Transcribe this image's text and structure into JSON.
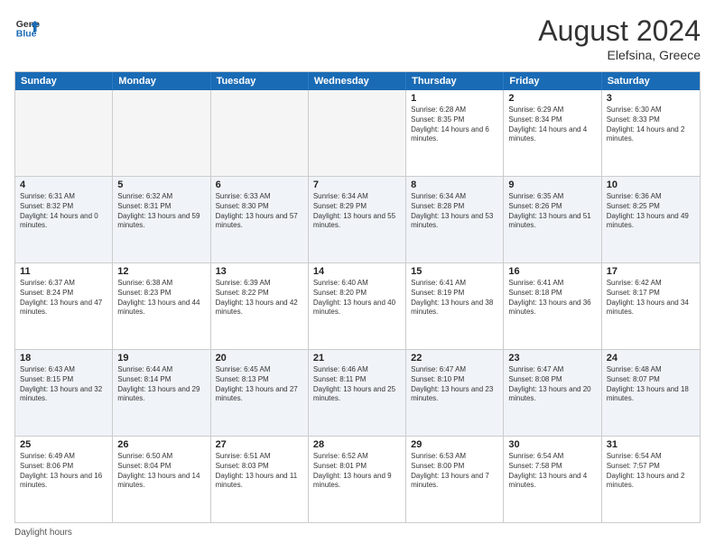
{
  "header": {
    "logo_general": "General",
    "logo_blue": "Blue",
    "month_year": "August 2024",
    "location": "Elefsina, Greece"
  },
  "days_of_week": [
    "Sunday",
    "Monday",
    "Tuesday",
    "Wednesday",
    "Thursday",
    "Friday",
    "Saturday"
  ],
  "rows": [
    [
      {
        "day": "",
        "text": "",
        "empty": true
      },
      {
        "day": "",
        "text": "",
        "empty": true
      },
      {
        "day": "",
        "text": "",
        "empty": true
      },
      {
        "day": "",
        "text": "",
        "empty": true
      },
      {
        "day": "1",
        "text": "Sunrise: 6:28 AM\nSunset: 8:35 PM\nDaylight: 14 hours and 6 minutes."
      },
      {
        "day": "2",
        "text": "Sunrise: 6:29 AM\nSunset: 8:34 PM\nDaylight: 14 hours and 4 minutes."
      },
      {
        "day": "3",
        "text": "Sunrise: 6:30 AM\nSunset: 8:33 PM\nDaylight: 14 hours and 2 minutes."
      }
    ],
    [
      {
        "day": "4",
        "text": "Sunrise: 6:31 AM\nSunset: 8:32 PM\nDaylight: 14 hours and 0 minutes."
      },
      {
        "day": "5",
        "text": "Sunrise: 6:32 AM\nSunset: 8:31 PM\nDaylight: 13 hours and 59 minutes."
      },
      {
        "day": "6",
        "text": "Sunrise: 6:33 AM\nSunset: 8:30 PM\nDaylight: 13 hours and 57 minutes."
      },
      {
        "day": "7",
        "text": "Sunrise: 6:34 AM\nSunset: 8:29 PM\nDaylight: 13 hours and 55 minutes."
      },
      {
        "day": "8",
        "text": "Sunrise: 6:34 AM\nSunset: 8:28 PM\nDaylight: 13 hours and 53 minutes."
      },
      {
        "day": "9",
        "text": "Sunrise: 6:35 AM\nSunset: 8:26 PM\nDaylight: 13 hours and 51 minutes."
      },
      {
        "day": "10",
        "text": "Sunrise: 6:36 AM\nSunset: 8:25 PM\nDaylight: 13 hours and 49 minutes."
      }
    ],
    [
      {
        "day": "11",
        "text": "Sunrise: 6:37 AM\nSunset: 8:24 PM\nDaylight: 13 hours and 47 minutes."
      },
      {
        "day": "12",
        "text": "Sunrise: 6:38 AM\nSunset: 8:23 PM\nDaylight: 13 hours and 44 minutes."
      },
      {
        "day": "13",
        "text": "Sunrise: 6:39 AM\nSunset: 8:22 PM\nDaylight: 13 hours and 42 minutes."
      },
      {
        "day": "14",
        "text": "Sunrise: 6:40 AM\nSunset: 8:20 PM\nDaylight: 13 hours and 40 minutes."
      },
      {
        "day": "15",
        "text": "Sunrise: 6:41 AM\nSunset: 8:19 PM\nDaylight: 13 hours and 38 minutes."
      },
      {
        "day": "16",
        "text": "Sunrise: 6:41 AM\nSunset: 8:18 PM\nDaylight: 13 hours and 36 minutes."
      },
      {
        "day": "17",
        "text": "Sunrise: 6:42 AM\nSunset: 8:17 PM\nDaylight: 13 hours and 34 minutes."
      }
    ],
    [
      {
        "day": "18",
        "text": "Sunrise: 6:43 AM\nSunset: 8:15 PM\nDaylight: 13 hours and 32 minutes."
      },
      {
        "day": "19",
        "text": "Sunrise: 6:44 AM\nSunset: 8:14 PM\nDaylight: 13 hours and 29 minutes."
      },
      {
        "day": "20",
        "text": "Sunrise: 6:45 AM\nSunset: 8:13 PM\nDaylight: 13 hours and 27 minutes."
      },
      {
        "day": "21",
        "text": "Sunrise: 6:46 AM\nSunset: 8:11 PM\nDaylight: 13 hours and 25 minutes."
      },
      {
        "day": "22",
        "text": "Sunrise: 6:47 AM\nSunset: 8:10 PM\nDaylight: 13 hours and 23 minutes."
      },
      {
        "day": "23",
        "text": "Sunrise: 6:47 AM\nSunset: 8:08 PM\nDaylight: 13 hours and 20 minutes."
      },
      {
        "day": "24",
        "text": "Sunrise: 6:48 AM\nSunset: 8:07 PM\nDaylight: 13 hours and 18 minutes."
      }
    ],
    [
      {
        "day": "25",
        "text": "Sunrise: 6:49 AM\nSunset: 8:06 PM\nDaylight: 13 hours and 16 minutes."
      },
      {
        "day": "26",
        "text": "Sunrise: 6:50 AM\nSunset: 8:04 PM\nDaylight: 13 hours and 14 minutes."
      },
      {
        "day": "27",
        "text": "Sunrise: 6:51 AM\nSunset: 8:03 PM\nDaylight: 13 hours and 11 minutes."
      },
      {
        "day": "28",
        "text": "Sunrise: 6:52 AM\nSunset: 8:01 PM\nDaylight: 13 hours and 9 minutes."
      },
      {
        "day": "29",
        "text": "Sunrise: 6:53 AM\nSunset: 8:00 PM\nDaylight: 13 hours and 7 minutes."
      },
      {
        "day": "30",
        "text": "Sunrise: 6:54 AM\nSunset: 7:58 PM\nDaylight: 13 hours and 4 minutes."
      },
      {
        "day": "31",
        "text": "Sunrise: 6:54 AM\nSunset: 7:57 PM\nDaylight: 13 hours and 2 minutes."
      }
    ]
  ],
  "footer": {
    "note": "Daylight hours"
  }
}
